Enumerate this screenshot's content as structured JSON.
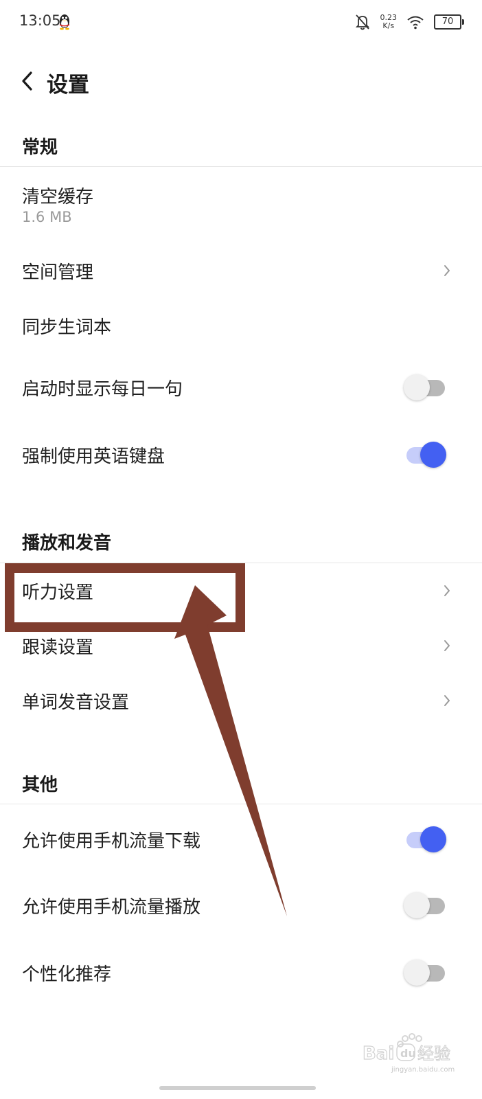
{
  "status_bar": {
    "time": "13:05",
    "net_speed_value": "0.23",
    "net_speed_unit": "K/s",
    "battery": "70",
    "icons": [
      "qq-penguin-icon",
      "mute-bell-icon",
      "wifi-icon",
      "battery-icon"
    ]
  },
  "header": {
    "title": "设置",
    "back_icon": "chevron-left-icon"
  },
  "sections": {
    "general": {
      "title": "常规",
      "clear_cache": {
        "label": "清空缓存",
        "size": "1.6 MB"
      },
      "space_management": {
        "label": "空间管理"
      },
      "sync_wordbook": {
        "label": "同步生词本"
      },
      "daily_sentence": {
        "label": "启动时显示每日一句",
        "enabled": false
      },
      "force_english_keyboard": {
        "label": "强制使用英语键盘",
        "enabled": true
      }
    },
    "playback": {
      "title": "播放和发音",
      "listening": {
        "label": "听力设置"
      },
      "follow_reading": {
        "label": "跟读设置"
      },
      "word_pronunciation": {
        "label": "单词发音设置"
      }
    },
    "other": {
      "title": "其他",
      "mobile_data_download": {
        "label": "允许使用手机流量下载",
        "enabled": true
      },
      "mobile_data_play": {
        "label": "允许使用手机流量播放",
        "enabled": false
      },
      "personalized_recommendation": {
        "label": "个性化推荐",
        "enabled": false
      }
    }
  },
  "annotation": {
    "color": "#7f3d2e"
  },
  "watermark": {
    "brand": "Baidu经验",
    "url": "jingyan.baidu.com"
  },
  "colors": {
    "accent": "#4360f2",
    "accent_track": "#c6cdfa"
  }
}
